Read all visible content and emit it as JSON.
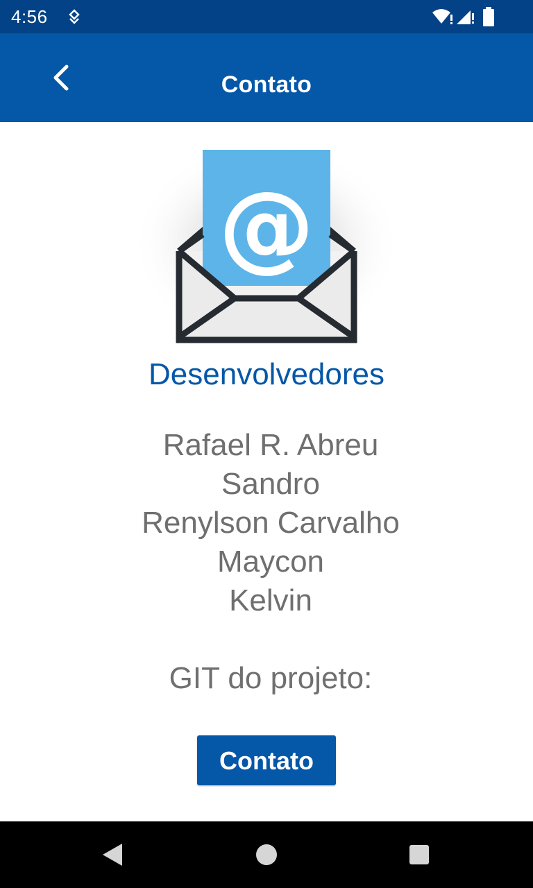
{
  "status_bar": {
    "time": "4:56",
    "icons": [
      "notification-icon",
      "wifi-icon",
      "signal-icon",
      "battery-icon"
    ]
  },
  "app_bar": {
    "title": "Contato",
    "back_icon": "chevron-left-icon"
  },
  "main": {
    "image": "email-envelope-illustration",
    "heading": "Desenvolvedores",
    "developers": [
      "Rafael R. Abreu",
      "Sandro",
      "Renylson Carvalho",
      "Maycon",
      "Kelvin"
    ],
    "git_label": "GIT do projeto:",
    "button_label": "Contato"
  },
  "nav_bar": {
    "icons": [
      "nav-back-icon",
      "nav-home-icon",
      "nav-recents-icon"
    ]
  },
  "colors": {
    "status_bar": "#034286",
    "app_bar": "#0557a8",
    "accent": "#0557a8",
    "body_text": "#6f6f6f",
    "envelope_paper": "#5db4e8",
    "envelope_outline": "#262a31"
  }
}
